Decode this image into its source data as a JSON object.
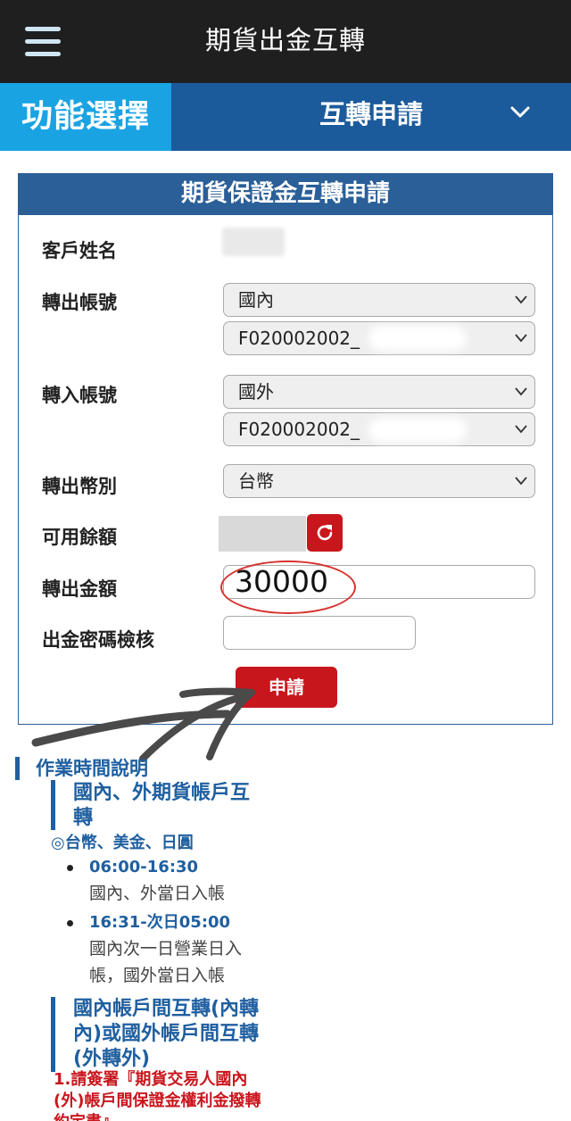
{
  "app": {
    "title": "期貨出金互轉"
  },
  "function_bar": {
    "label": "功能選擇",
    "selected": "互轉申請"
  },
  "form": {
    "header": "期貨保證金互轉申請",
    "customer_name_label": "客戶姓名",
    "out_account_label": "轉出帳號",
    "out_account_type": "國內",
    "out_account_number": "F020002002_",
    "in_account_label": "轉入帳號",
    "in_account_type": "國外",
    "in_account_number": "F020002002_",
    "currency_label": "轉出幣別",
    "currency": "台幣",
    "available_label": "可用餘額",
    "amount_label": "轉出金額",
    "amount_value": "30000",
    "password_label": "出金密碼檢核",
    "submit_label": "申請"
  },
  "info": {
    "section_title": "作業時間說明",
    "sub1_title_line1": "國內、外期貨帳戶互",
    "sub1_title_line2": "轉",
    "currencies": "◎台幣、美金、日圓",
    "items": [
      {
        "time": "06:00-16:30",
        "desc_line1": "國內、外當日入帳",
        "desc_line2": ""
      },
      {
        "time": "16:31-次日05:00",
        "desc_line1": "國內次一日營業日入",
        "desc_line2": "帳，國外當日入帳"
      }
    ],
    "sub2_title_line1": "國內帳戶間互轉(內轉",
    "sub2_title_line2": "內)或國外帳戶間互轉",
    "sub2_title_line3": "(外轉外)",
    "note_line1": "1.請簽署『期貨交易人國內",
    "note_line2": "(外)帳戶間保證金權利金撥轉",
    "note_line3": "約定書』"
  }
}
